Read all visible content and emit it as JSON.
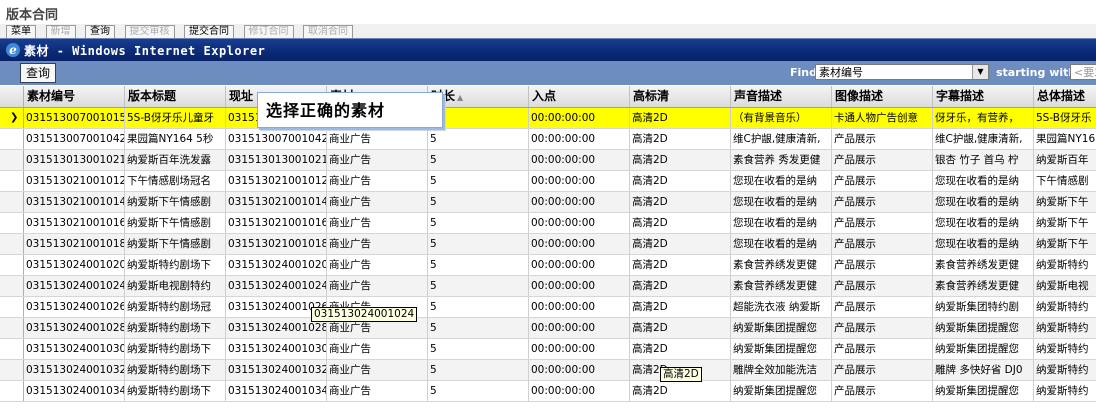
{
  "background_app": {
    "title": "版本合同",
    "toolbar_buttons": [
      "菜单",
      "新增",
      "查询",
      "提交审核",
      "提交合同",
      "修订合同",
      "取消合同"
    ]
  },
  "window": {
    "title": "素材 - Windows Internet Explorer",
    "icon": "internet-explorer-icon"
  },
  "toolbar": {
    "query_label": "查询",
    "find_label": "Find",
    "find_field": "素材编号",
    "starting_with_label": "starting with",
    "starting_with_placeholder": "<要求>"
  },
  "popup_hint": "选择正确的素材",
  "columns": [
    "素材编号",
    "版本标题",
    "现址",
    "素材",
    "时长",
    "入点",
    "高标清",
    "声音描述",
    "图像描述",
    "字幕描述",
    "总体描述"
  ],
  "rows": [
    [
      "031513007001015",
      "5S-B伢牙乐儿童牙",
      "0315130",
      "",
      "",
      "00:00:00:00",
      "高清2D",
      "（有背景音乐）",
      "卡通人物广告创意",
      "伢牙乐，有营养，",
      "5S-B伢牙乐"
    ],
    [
      "031513007001042",
      "果园篇NY164 5秒",
      "031513007001042",
      "商业广告",
      "5",
      "00:00:00:00",
      "高清2D",
      "维C护龈,健康清新,",
      "产品展示",
      "维C护龈,健康清新,",
      "果园篇NY16"
    ],
    [
      "031513013001021",
      "纳爱斯百年洗发露",
      "031513013001021",
      "商业广告",
      "5",
      "00:00:00:00",
      "高清2D",
      "素食营养 秀发更健",
      "产品展示",
      "银杏 竹子 首乌 柠",
      "纳爱斯百年"
    ],
    [
      "031513021001012",
      "下午情感剧场冠名",
      "031513021001012",
      "商业广告",
      "5",
      "00:00:00:00",
      "高清2D",
      "您现在收看的是纳",
      "产品展示",
      "您现在收看的是纳",
      "下午情感剧"
    ],
    [
      "031513021001014",
      "纳爱斯下午情感剧",
      "031513021001014",
      "商业广告",
      "5",
      "00:00:00:00",
      "高清2D",
      "您现在收看的是纳",
      "产品展示",
      "您现在收看的是纳",
      "纳爱斯下午"
    ],
    [
      "031513021001016",
      "纳爱斯下午情感剧",
      "031513021001016",
      "商业广告",
      "5",
      "00:00:00:00",
      "高清2D",
      "您现在收看的是纳",
      "产品展示",
      "您现在收看的是纳",
      "纳爱斯下午"
    ],
    [
      "031513021001018",
      "纳爱斯下午情感剧",
      "031513021001018",
      "商业广告",
      "5",
      "00:00:00:00",
      "高清2D",
      "您现在收看的是纳",
      "产品展示",
      "您现在收看的是纳",
      "纳爱斯下午"
    ],
    [
      "031513024001020",
      "纳爱斯特约剧场下",
      "031513024001020",
      "商业广告",
      "5",
      "00:00:00:00",
      "高清2D",
      "素食营养绣发更健",
      "产品展示",
      "素食营养绣发更健",
      "纳爱斯特约"
    ],
    [
      "031513024001024",
      "纳爱斯电视剧特约",
      "031513024001024",
      "商业广告",
      "5",
      "00:00:00:00",
      "高清2D",
      "素食营养绣发更健",
      "产品展示",
      "素食营养绣发更健",
      "纳爱斯电视"
    ],
    [
      "031513024001026",
      "纳爱斯特约剧场冠",
      "031513024001026",
      "商业广告",
      "5",
      "00:00:00:00",
      "高清2D",
      "超能洗衣液 纳爱斯",
      "产品展示",
      "纳爱斯集团特约剧",
      "纳爱斯特约"
    ],
    [
      "031513024001028",
      "纳爱斯特约剧场下",
      "031513024001028",
      "商业广告",
      "5",
      "00:00:00:00",
      "高清2D",
      "纳爱斯集团提醒您",
      "产品展示",
      "纳爱斯集团提醒您",
      "纳爱斯特约"
    ],
    [
      "031513024001030",
      "纳爱斯特约剧场下",
      "031513024001030",
      "商业广告",
      "5",
      "00:00:00:00",
      "高清2D",
      "纳爱斯集团提醒您",
      "产品展示",
      "纳爱斯集团提醒您",
      "纳爱斯特约"
    ],
    [
      "031513024001032",
      "纳爱斯特约剧场下",
      "031513024001032",
      "商业广告",
      "5",
      "00:00:00:00",
      "高清2D",
      "雕牌全效加能洗洁",
      "产品展示",
      "雕牌 多快好省 DJ0",
      "纳爱斯特约"
    ],
    [
      "031513024001034",
      "纳爱斯特约剧场下",
      "031513024001034",
      "商业广告",
      "5",
      "00:00:00:00",
      "高清2D",
      "纳爱斯集团提醒您",
      "产品展示",
      "纳爱斯集团提醒您",
      "纳爱斯特约"
    ]
  ],
  "tooltips": {
    "row_tooltip": "031513024001024",
    "cell_tooltip": "高清2D"
  },
  "colors": {
    "selected_row": "#ffff00",
    "toolbar_bg": "#6d8cc0",
    "titlebar_bg": "#0a2a77"
  }
}
